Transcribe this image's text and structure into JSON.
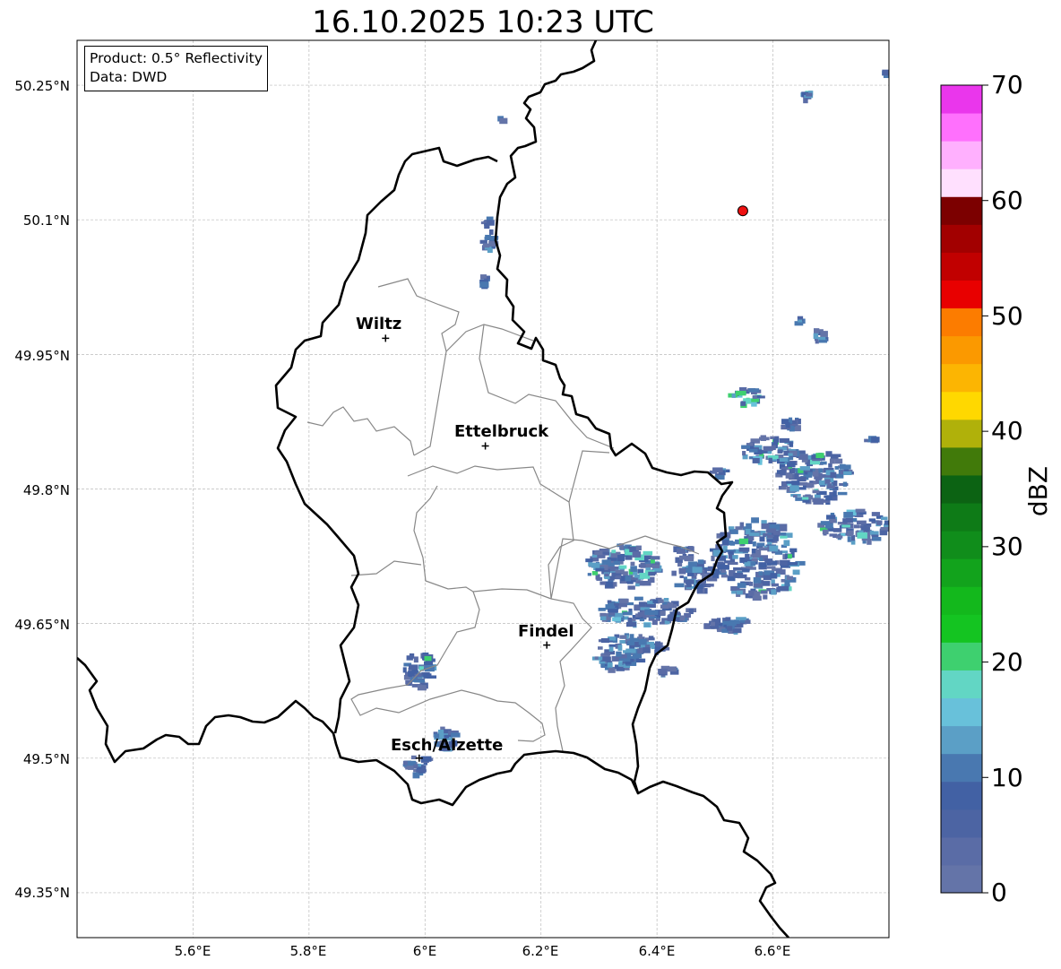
{
  "title": "16.10.2025 10:23 UTC",
  "info": {
    "product": "Product: 0.5° Reflectivity",
    "source": "Data: DWD"
  },
  "axes": {
    "lat_labels": [
      "50.25°N",
      "50.1°N",
      "49.95°N",
      "49.8°N",
      "49.65°N",
      "49.5°N",
      "49.35°N"
    ],
    "lon_labels": [
      "5.6°E",
      "5.8°E",
      "6°E",
      "6.2°E",
      "6.4°E",
      "6.6°E"
    ],
    "lat_values": [
      50.25,
      50.1,
      49.95,
      49.8,
      49.65,
      49.5,
      49.35
    ],
    "lon_values": [
      5.6,
      5.8,
      6.0,
      6.2,
      6.4,
      6.6
    ],
    "lat_range": [
      49.3,
      50.3
    ],
    "lon_range": [
      5.4,
      6.8
    ],
    "grid": true
  },
  "cities": [
    {
      "name": "Wiltz",
      "lat": 49.968,
      "lon": 5.932
    },
    {
      "name": "Ettelbruck",
      "lat": 49.848,
      "lon": 6.104
    },
    {
      "name": "Findel",
      "lat": 49.626,
      "lon": 6.21
    },
    {
      "name": "Esch/Alzette",
      "lat": 49.5,
      "lon": 5.99
    }
  ],
  "radar_site": {
    "lat": 50.11,
    "lon": 6.548,
    "color": "#ee1111"
  },
  "colorbar": {
    "label": "dBZ",
    "min": 0,
    "max": 70,
    "step": 2.5,
    "tick_values": [
      0,
      10,
      20,
      30,
      40,
      50,
      60,
      70
    ],
    "tick_labels": [
      "0",
      "10",
      "20",
      "30",
      "40",
      "50",
      "60",
      "70"
    ],
    "colors": [
      "#6474a8",
      "#5a6ca6",
      "#4c64a3",
      "#4261a4",
      "#4978b0",
      "#5b9fc6",
      "#68c1da",
      "#62d6c4",
      "#3ed06f",
      "#14c421",
      "#13b81c",
      "#12a31c",
      "#108d1b",
      "#0e7b17",
      "#0c6313",
      "#417a0a",
      "#b0b10a",
      "#ffd800",
      "#fcb502",
      "#fb9900",
      "#fc7c00",
      "#e80000",
      "#c10000",
      "#a20000",
      "#7c0000",
      "#ffe0fe",
      "#ffb0fe",
      "#ff70fd",
      "#ea36ec"
    ]
  },
  "colors": {
    "country_border": "#000000",
    "canton_border": "#888888",
    "grid": "#bbbbbb"
  }
}
